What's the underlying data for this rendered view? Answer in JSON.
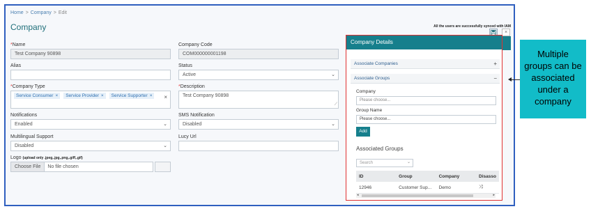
{
  "breadcrumb": {
    "home": "Home",
    "company": "Company",
    "current": "Edit",
    "sep": ">"
  },
  "page_title": "Company",
  "sync_message": "All the users are successfully synced with IAM",
  "toolbar": {
    "save_icon": "save-icon",
    "close_glyph": "×"
  },
  "fields": {
    "name": {
      "label": "Name",
      "value": "Test Company 90898"
    },
    "company_code": {
      "label": "Company Code",
      "value": "COM000000001198"
    },
    "alias": {
      "label": "Alias",
      "value": ""
    },
    "status": {
      "label": "Status",
      "value": "Active"
    },
    "company_type": {
      "label": "Company Type",
      "chips": [
        "Service Consumer",
        "Service Provider",
        "Service Supporter"
      ]
    },
    "description": {
      "label": "Description",
      "value": "Test Company 90898"
    },
    "notifications": {
      "label": "Notifications",
      "value": "Enabled"
    },
    "sms_notification": {
      "label": "SMS Notification",
      "value": "Disabled"
    },
    "multilingual": {
      "label": "Multilingual Support",
      "value": "Disabled"
    },
    "lucy_url": {
      "label": "Lucy Url",
      "value": ""
    },
    "logo": {
      "label": "Logo",
      "hint": "(upload only .jpeg,.jpg,.png,.giff,.gif)",
      "button": "Choose File",
      "file": "No file chosen"
    }
  },
  "panel": {
    "title": "Company Details",
    "acc_companies": {
      "label": "Associate Companies",
      "sign": "+"
    },
    "acc_groups": {
      "label": "Associate Groups",
      "sign": "−"
    },
    "company_label": "Company",
    "company_placeholder": "Please choose...",
    "group_label": "Group Name",
    "group_value": "Please choose...",
    "add_button": "Add",
    "assoc_title": "Associated Groups",
    "search_placeholder": "Search",
    "table": {
      "headers": [
        "ID",
        "Group",
        "Company",
        "Disasso"
      ],
      "rows": [
        [
          "12946",
          "Customer Sup...",
          "Demo",
          ""
        ]
      ]
    }
  },
  "callout": "Multiple groups can be associated under a company",
  "colors": {
    "accent": "#167f8c",
    "highlight_border": "#e03030",
    "frame_border": "#2f5fbf",
    "callout_bg": "#12bcc8"
  }
}
